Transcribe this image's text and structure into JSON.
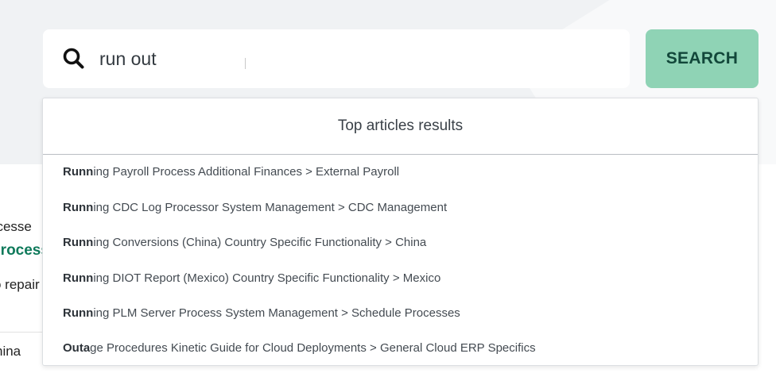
{
  "search": {
    "query": "run out",
    "button_label": "SEARCH"
  },
  "background_page": {
    "line1": "ocesse",
    "line2": "Process",
    "line3": "o repair",
    "line4": "hina"
  },
  "dropdown": {
    "title": "Top articles results",
    "results": [
      {
        "match": "Runn",
        "rest": "ing Payroll Process Additional Finances > External Payroll"
      },
      {
        "match": "Runn",
        "rest": "ing CDC Log Processor System Management > CDC Management"
      },
      {
        "match": "Runn",
        "rest": "ing Conversions (China) Country Specific Functionality > China"
      },
      {
        "match": "Runn",
        "rest": "ing DIOT Report (Mexico) Country Specific Functionality > Mexico"
      },
      {
        "match": "Runn",
        "rest": "ing PLM Server Process System Management > Schedule Processes"
      },
      {
        "match": "Outa",
        "rest": "ge Procedures Kinetic Guide for Cloud Deployments > General Cloud ERP Specifics"
      }
    ]
  },
  "colors": {
    "button_bg": "#8fd3b5",
    "button_text": "#12473a",
    "link_green": "#0f7a5b"
  },
  "icons": {
    "search": "search-icon"
  }
}
